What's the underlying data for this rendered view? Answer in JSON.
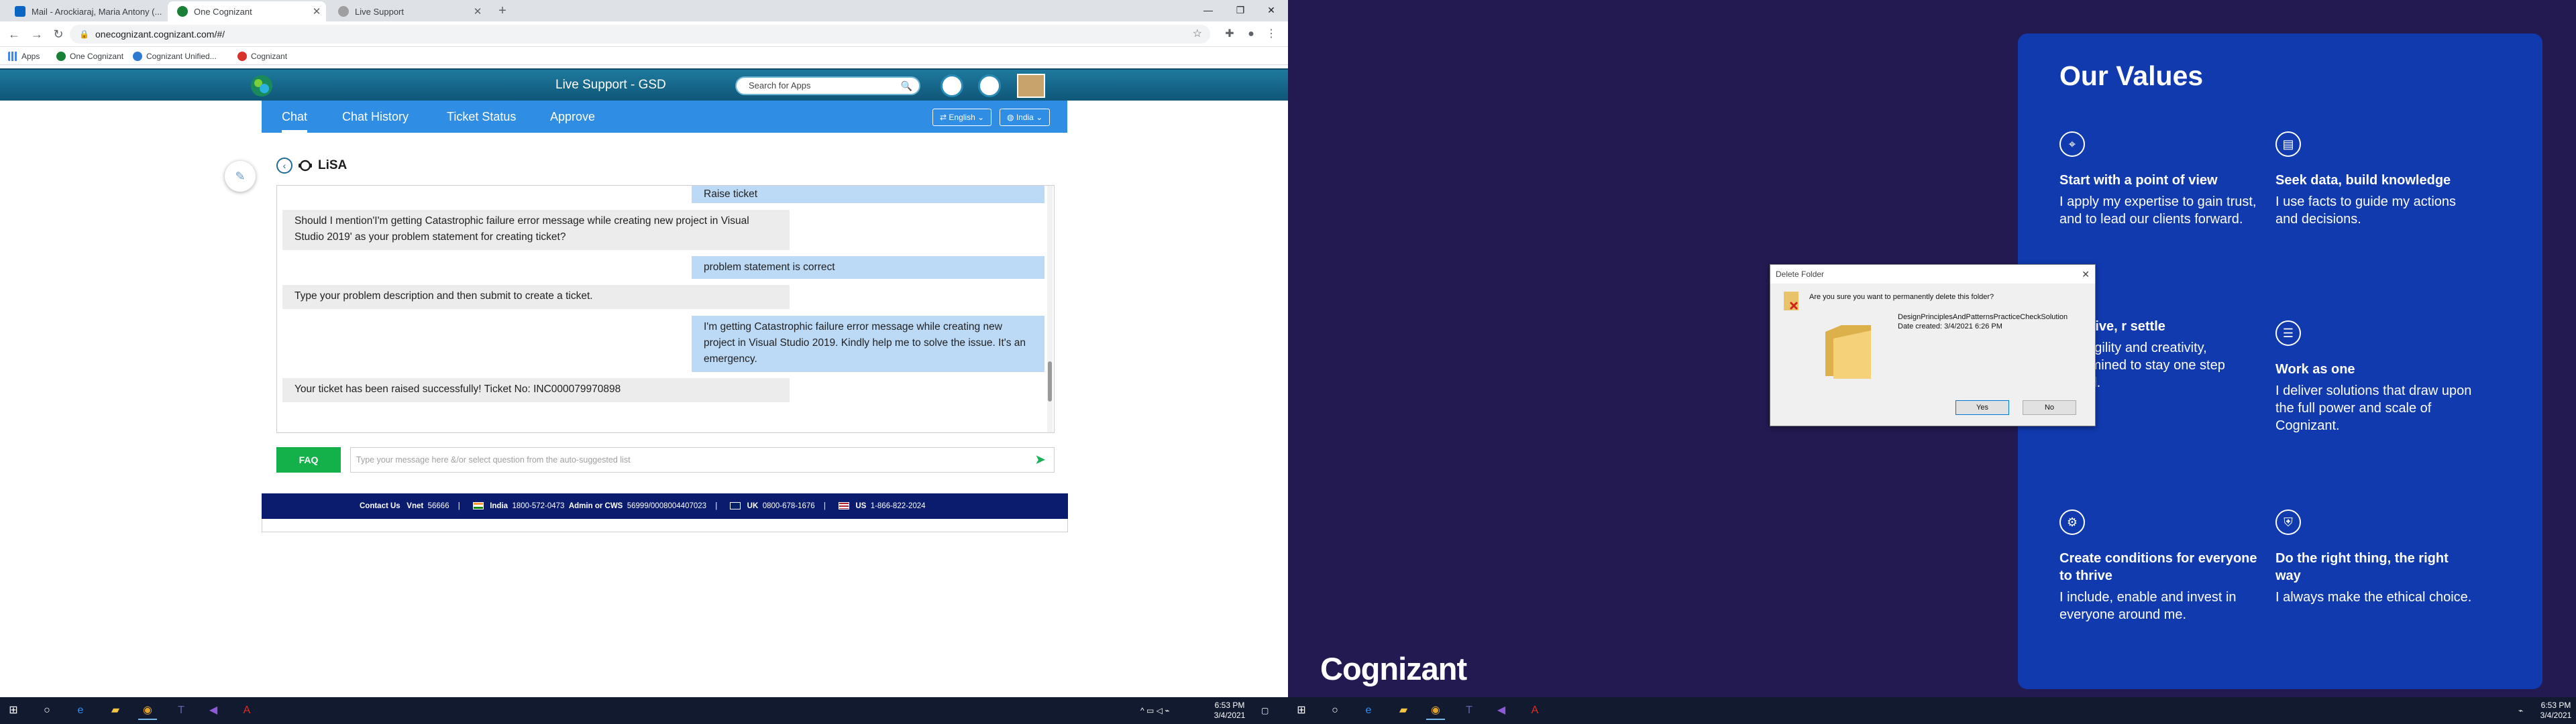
{
  "browser": {
    "tabs": [
      {
        "label": "Mail - Arockiaraj, Maria Antony (...",
        "active": false,
        "color": "#0a64c4"
      },
      {
        "label": "One Cognizant",
        "active": true,
        "color": "#1a7f37"
      },
      {
        "label": "Live Support",
        "active": false,
        "color": "#777777"
      }
    ],
    "url": "onecognizant.cognizant.com/#/",
    "bookmarks": [
      "Apps",
      "One Cognizant",
      "Cognizant Unified...",
      "Cognizant"
    ]
  },
  "app": {
    "title": "Live Support - GSD",
    "search_placeholder": "Search for Apps",
    "nav_tabs": [
      "Chat",
      "Chat History",
      "Ticket Status",
      "Approve"
    ],
    "language": "English",
    "country": "India",
    "bot_name": "LiSA"
  },
  "chat": {
    "messages": [
      {
        "from": "user",
        "text": "Raise ticket"
      },
      {
        "from": "bot",
        "text": "Should I mention'I'm getting Catastrophic failure error message while creating new project in Visual Studio 2019' as your problem statement for creating ticket?"
      },
      {
        "from": "user",
        "text": "problem statement is correct"
      },
      {
        "from": "bot",
        "text": "Type your problem description and then submit to create a ticket."
      },
      {
        "from": "user",
        "text": "I'm getting Catastrophic failure error message while creating new project in Visual Studio 2019. Kindly help me to solve the issue. It's an emergency."
      },
      {
        "from": "bot",
        "text": "Your ticket has been raised successfully! Ticket No:  INC000079970898"
      }
    ],
    "faq_label": "FAQ",
    "input_placeholder": "Type your message here &/or select question from the auto-suggested list"
  },
  "footer": {
    "contact_label": "Contact Us",
    "vnet_label": "Vnet",
    "vnet": "56666",
    "india_label": "India",
    "india": "1800-572-0473",
    "admin_label": "Admin or CWS",
    "admin": "56999/0008004407023",
    "uk_label": "UK",
    "uk": "0800-678-1676",
    "us_label": "US",
    "us": "1-866-822-2024"
  },
  "taskbar_left": {
    "time": "6:53 PM",
    "date": "3/4/2021"
  },
  "taskbar_right": {
    "time": "6:53 PM",
    "date": "3/4/2021"
  },
  "values": {
    "title": "Our Values",
    "items": [
      {
        "head": "Start with a point of view",
        "body": "I apply my expertise to gain trust, and to lead our clients forward."
      },
      {
        "head": "Seek data, build knowledge",
        "body": "I use facts to guide my actions and decisions."
      },
      {
        "head": "ys strive, r settle",
        "body": "with agility and creativity, determined to stay one step ahead."
      },
      {
        "head": "Work as one",
        "body": "I deliver solutions that draw upon the full power and scale of Cognizant."
      },
      {
        "head": "Create conditions for everyone to thrive",
        "body": "I include, enable and invest in everyone around me."
      },
      {
        "head": "Do the right thing, the right way",
        "body": "I always make the ethical choice."
      }
    ]
  },
  "brand": "Cognizant",
  "dialog": {
    "title": "Delete Folder",
    "question": "Are you sure you want to permanently delete this folder?",
    "name": "DesignPrinciplesAndPatternsPracticeCheckSolution",
    "date": "Date created: 3/4/2021 6:26 PM",
    "yes": "Yes",
    "no": "No"
  },
  "colors": {
    "chat_nav": "#2f8de4",
    "user_bubble": "#bcd9f6",
    "bot_bubble": "#ececec",
    "faq": "#14b14b",
    "footer": "#0b1b6e",
    "values_card": "#103aae",
    "desktop_bg": "#231a51"
  }
}
